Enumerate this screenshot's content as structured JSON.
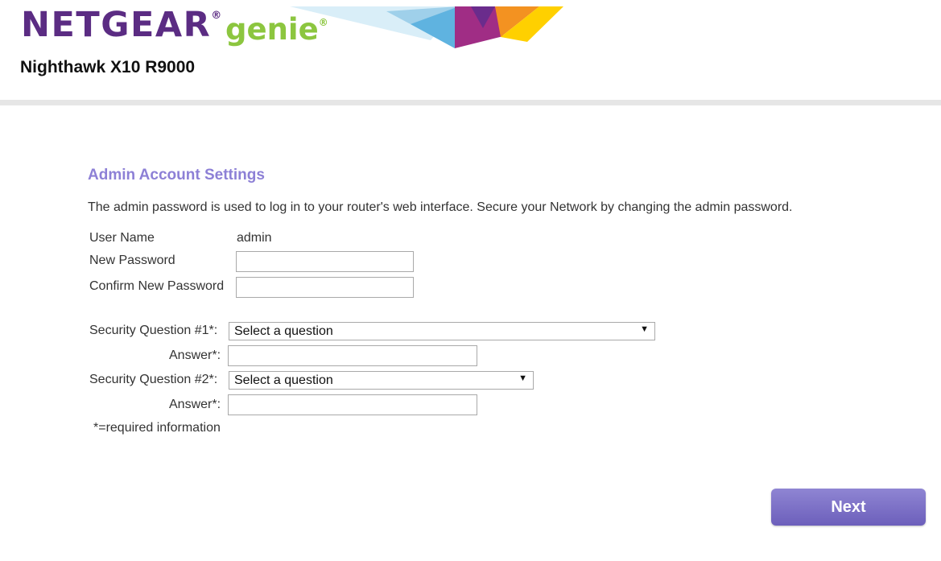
{
  "header": {
    "brand": "NETGEAR",
    "brand_mark": "®",
    "product": "genie",
    "product_mark": "®",
    "model": "Nighthawk X10 R9000"
  },
  "colors": {
    "brand_purple": "#5b2c83",
    "genie_green": "#8cc63f",
    "title_lavender": "#8d80d6",
    "button_purple": "#7468c3"
  },
  "page": {
    "title": "Admin Account Settings",
    "description": "The admin password is used to log in to your router's web interface. Secure your Network by changing the admin password."
  },
  "form": {
    "username_label": "User Name",
    "username_value": "admin",
    "new_password_label": "New Password",
    "new_password_value": "",
    "confirm_password_label": "Confirm New Password",
    "confirm_password_value": "",
    "question1_label": "Security Question #1*:",
    "question1_selected": "Select a question",
    "answer1_label": "Answer*:",
    "answer1_value": "",
    "question2_label": "Security Question #2*:",
    "question2_selected": "Select a question",
    "answer2_label": "Answer*:",
    "answer2_value": "",
    "required_note": "*=required information"
  },
  "actions": {
    "next_label": "Next"
  },
  "icons": {
    "dropdown": "triangle-down-icon"
  }
}
